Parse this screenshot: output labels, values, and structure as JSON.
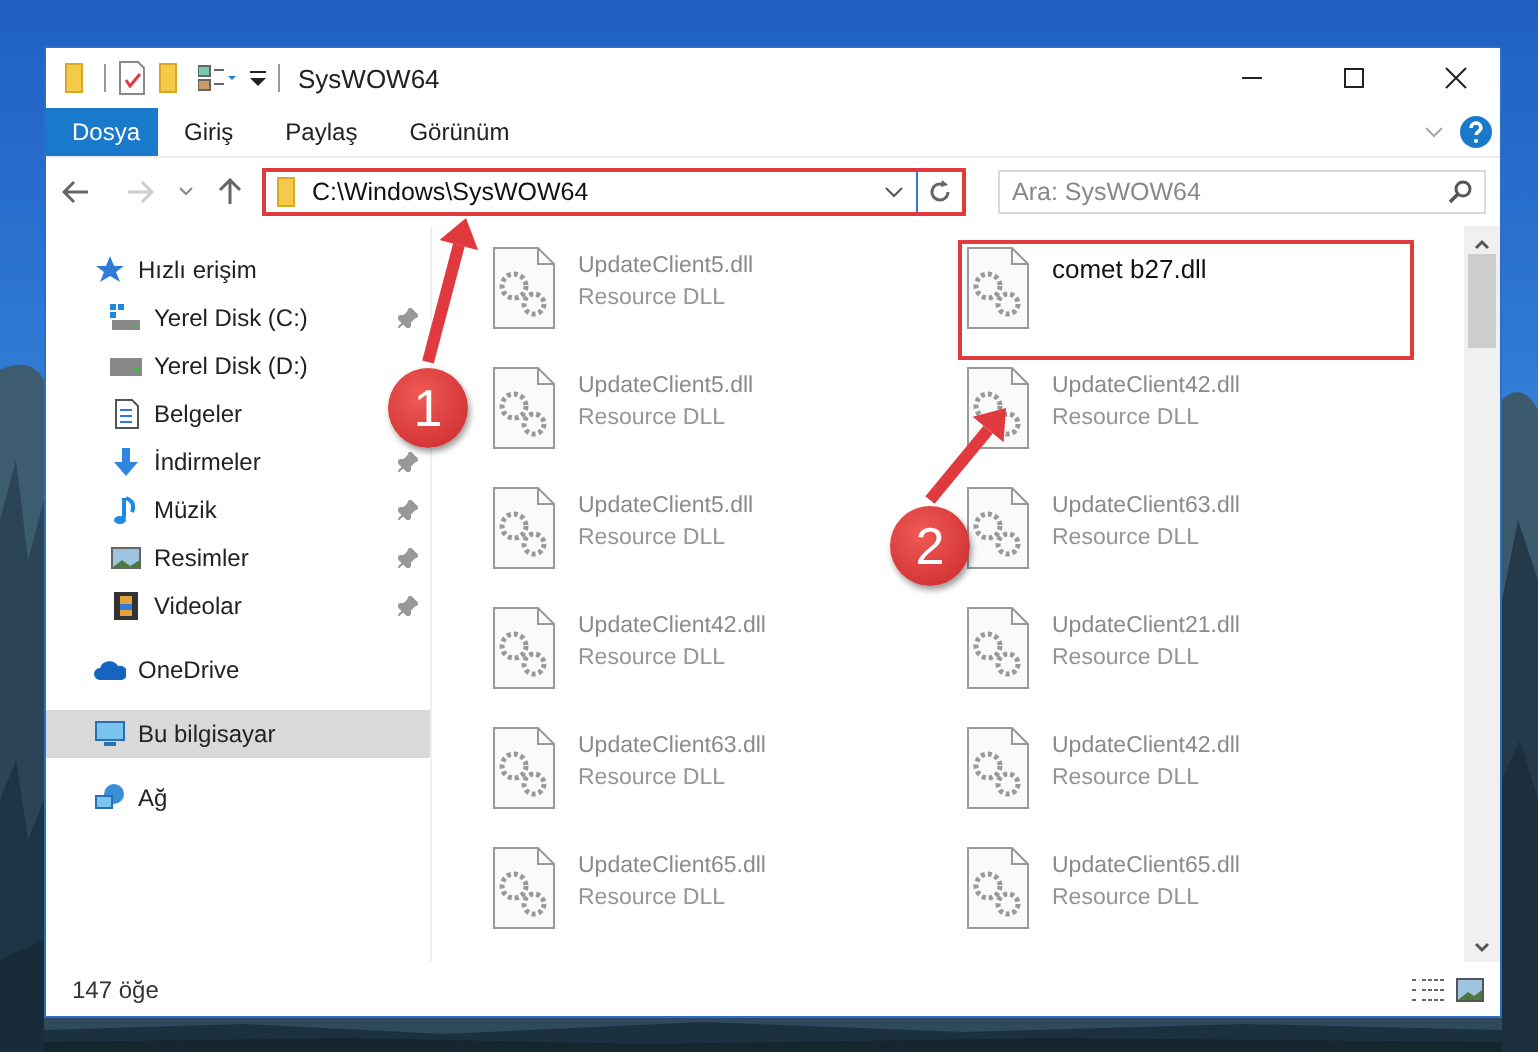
{
  "window": {
    "title": "SysWOW64"
  },
  "ribbon_tabs": [
    {
      "label": "Dosya",
      "selected": true
    },
    {
      "label": "Giriş",
      "selected": false
    },
    {
      "label": "Paylaş",
      "selected": false
    },
    {
      "label": "Görünüm",
      "selected": false
    }
  ],
  "address": {
    "path": "C:\\Windows\\SysWOW64"
  },
  "search": {
    "placeholder": "Ara: SysWOW64"
  },
  "sidebar": {
    "items": [
      {
        "label": "Hızlı erişim",
        "kind": "star",
        "selected": false,
        "children": [
          {
            "label": "Yerel Disk (C:)",
            "kind": "windows-drive",
            "pinned": true
          },
          {
            "label": "Yerel Disk (D:)",
            "kind": "drive",
            "pinned": false
          },
          {
            "label": "Belgeler",
            "kind": "documents",
            "pinned": false
          },
          {
            "label": "İndirmeler",
            "kind": "download",
            "pinned": true
          },
          {
            "label": "Müzik",
            "kind": "music",
            "pinned": true
          },
          {
            "label": "Resimler",
            "kind": "pictures",
            "pinned": true
          },
          {
            "label": "Videolar",
            "kind": "videos",
            "pinned": true
          }
        ]
      },
      {
        "label": "OneDrive",
        "kind": "cloud",
        "selected": false
      },
      {
        "label": "Bu bilgisayar",
        "kind": "computer",
        "selected": true
      },
      {
        "label": "Ağ",
        "kind": "network",
        "selected": false
      }
    ]
  },
  "files": [
    {
      "name": "UpdateClient5.dll",
      "type": "Resource DLL",
      "blurred": true
    },
    {
      "name": "comet b27.dll",
      "blurred": false
    },
    {
      "name": "UpdateClient5.dll",
      "type": "Resource DLL",
      "blurred": true
    },
    {
      "name": "UpdateClient42.dll",
      "type": "Resource DLL",
      "blurred": true
    },
    {
      "name": "UpdateClient5.dll",
      "type": "Resource DLL",
      "blurred": true
    },
    {
      "name": "UpdateClient63.dll",
      "type": "Resource DLL",
      "blurred": true
    },
    {
      "name": "UpdateClient42.dll",
      "type": "Resource DLL",
      "blurred": true
    },
    {
      "name": "UpdateClient21.dll",
      "type": "Resource DLL",
      "blurred": true
    },
    {
      "name": "UpdateClient63.dll",
      "type": "Resource DLL",
      "blurred": true
    },
    {
      "name": "UpdateClient42.dll",
      "type": "Resource DLL",
      "blurred": true
    },
    {
      "name": "UpdateClient65.dll",
      "type": "Resource DLL",
      "blurred": true
    },
    {
      "name": "UpdateClient65.dll",
      "type": "Resource DLL",
      "blurred": true
    }
  ],
  "status_bar": {
    "count": "147 öğe"
  },
  "annotations": [
    {
      "number": "1"
    },
    {
      "number": "2"
    }
  ]
}
